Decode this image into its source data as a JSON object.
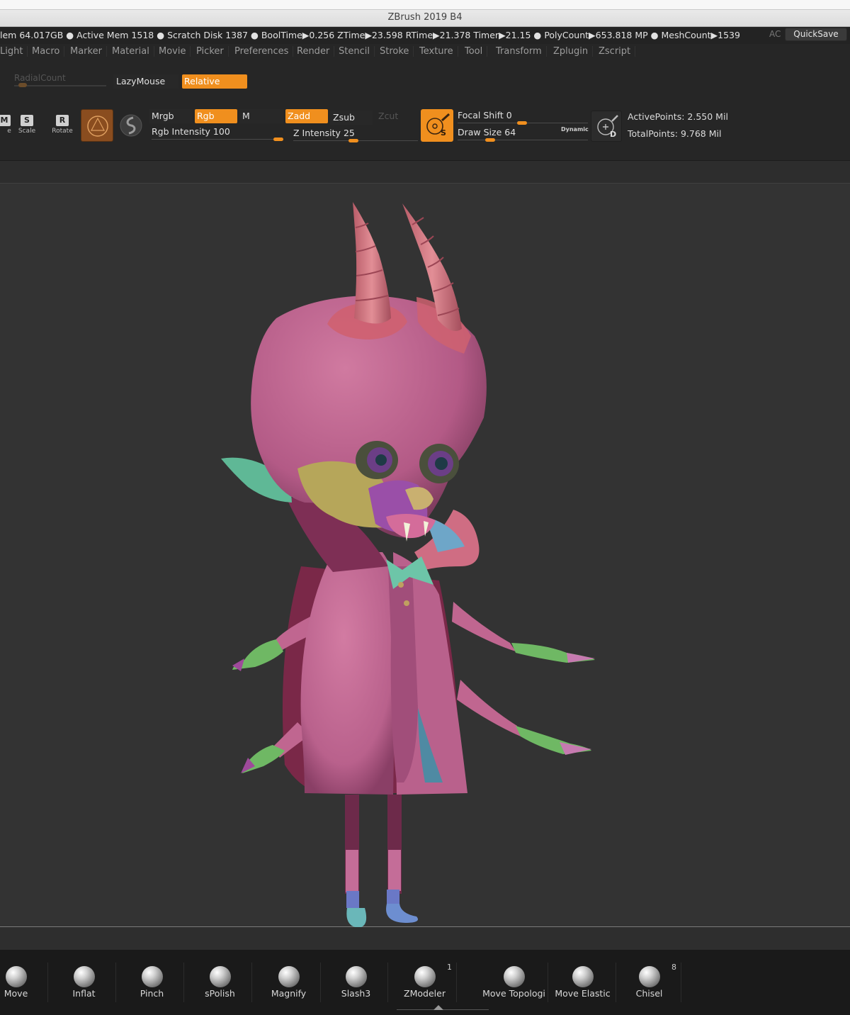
{
  "window": {
    "title": "ZBrush 2019 B4"
  },
  "status": {
    "info": "lem 64.017GB ● Active Mem 1518 ● Scratch Disk 1387 ●  BoolTime▶0.256 ZTime▶23.598 RTime▶21.378 Timer▶21.15 ● PolyCount▶653.818 MP  ● MeshCount▶1539",
    "ac": "AC",
    "quicksave": "QuickSave"
  },
  "menu": {
    "items": [
      "Light",
      "Macro",
      "Marker",
      "Material",
      "Movie",
      "Picker",
      "Preferences",
      "Render",
      "Stencil",
      "Stroke",
      "Texture",
      "Tool",
      "Transform",
      "Zplugin",
      "Zscript"
    ]
  },
  "top_shelf": {
    "radial_count": "RadialCount",
    "lazymouse": "LazyMouse",
    "relative": "Relative"
  },
  "tools": {
    "move_letter": "M",
    "move_partial": "e",
    "scale_letter": "S",
    "scale": "Scale",
    "rotate_letter": "R",
    "rotate": "Rotate"
  },
  "color_modes": {
    "mrgb": "Mrgb",
    "rgb": "Rgb",
    "m": "M",
    "rgb_intensity_label": "Rgb Intensity",
    "rgb_intensity_value": "100",
    "rgb_intensity_level": 1.0
  },
  "z_modes": {
    "zadd": "Zadd",
    "zsub": "Zsub",
    "zcut": "Zcut",
    "z_intensity_label": "Z Intensity",
    "z_intensity_value": "25",
    "z_intensity_level": 0.25
  },
  "brush_settings": {
    "focal_shift_label": "Focal Shift",
    "focal_shift_value": "0",
    "draw_size_label": "Draw Size",
    "draw_size_value": "64",
    "dynamic": "Dynamic",
    "brush_letter": "S",
    "d_letter": "D"
  },
  "points": {
    "active_label": "ActivePoints:",
    "active_value": "2.550 Mil",
    "total_label": "TotalPoints:",
    "total_value": "9.768 Mil"
  },
  "brushes": [
    {
      "label": "Move",
      "count": ""
    },
    {
      "label": "Inflat",
      "count": ""
    },
    {
      "label": "Pinch",
      "count": ""
    },
    {
      "label": "sPolish",
      "count": ""
    },
    {
      "label": "Magnify",
      "count": ""
    },
    {
      "label": "Slash3",
      "count": ""
    },
    {
      "label": "ZModeler",
      "count": "1"
    },
    {
      "label": "Move Topologi",
      "count": ""
    },
    {
      "label": "Move Elastic",
      "count": ""
    },
    {
      "label": "Chisel",
      "count": "8"
    }
  ],
  "colors": {
    "accent": "#f08f1e",
    "canvas_bg": "#333333",
    "skin_pink": "#c0648e",
    "coat_pink": "#c97099",
    "horn": "#d97a86",
    "green_polygroup": "#5fb896",
    "yellow_polygroup": "#b6a65a"
  }
}
